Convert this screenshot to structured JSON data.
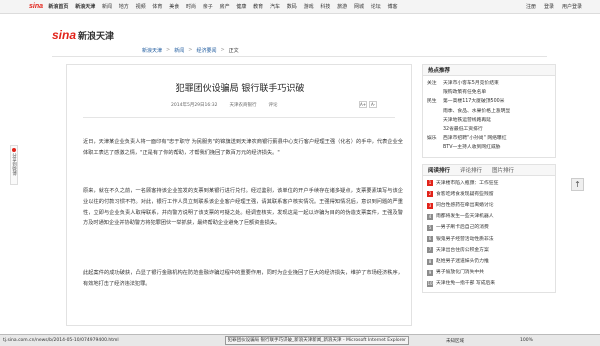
{
  "topnav": {
    "logo": "sina",
    "items": [
      "新浪首页",
      "新浪天津",
      "新闻",
      "地方",
      "视频",
      "体育",
      "美食",
      "时尚",
      "亲子",
      "房产",
      "健康",
      "教育",
      "汽车",
      "数码",
      "游戏",
      "科技",
      "旅游",
      "网城",
      "论坛",
      "博客"
    ],
    "register": "注册",
    "login": "登录",
    "user_center": "用户登录"
  },
  "brand": {
    "sina": "sina",
    "site": "新浪天津"
  },
  "breadcrumb": {
    "home": "新浪天津",
    "sep": ">",
    "news": "新闻",
    "economy": "经济要闻",
    "current": "正文"
  },
  "share": {
    "label": "分享到微博"
  },
  "article": {
    "title": "犯罪团伙设骗局 银行联手巧识破",
    "date": "2014年5月29日16:32",
    "source": "天津农商银行",
    "comment": "评论",
    "font_bigger": "A+",
    "font_smaller": "A-",
    "paragraphs": [
      "近日，天津某企业负责人将一面印有\"忠于职守 为民服务\"的锦旗送到天津农商银行蓟县中心支行客户经理王强（化名）的手中，代表企业全体职工表达了感激之情，\"正是有了你的帮助，才帮我们挽回了数百万元的经济损失。\"",
      "原来，就在不久之前，一名顾客持该企业签发的支票到某银行进行兑付。经过鉴别，该单位的开户手续存在诸多疑点，支票要素填写与该企业以往的付款习惯不符。对此，银行工作人员立刻联系该企业客户经理王强，请其联系客户核实情况。王强得知情况后，意识到问题的严重性，立即与企业负责人取得联系，并向警方说明了该支票的可疑之处。经调查核实，发现这是一起以诈骗为目的的伪造支票案件，王强及警方及时通知企业并协助警方将犯罪团伙一举抓获，最终帮助企业避免了巨额资金损失。",
      "此起案件的成功破获，凸显了银行金融机构在防范金融诈骗过程中的重要作用，同时为企业挽回了巨大的经济损失，维护了市场经济秩序，有效地打击了经济违法犯罪。"
    ]
  },
  "hot_recommend": {
    "title": "热点推荐",
    "rows": [
      {
        "cat": "关注",
        "text": "天津市小客车5月竞价结束"
      },
      {
        "cat": "",
        "text": "限购政策有任免名单"
      },
      {
        "cat": "民生",
        "text": "第一高楼117大厦破顶500米"
      },
      {
        "cat": "",
        "text": "雨季、食品、水果价格上涨明显"
      },
      {
        "cat": "",
        "text": "天津地铁运营线路再延"
      },
      {
        "cat": "",
        "text": "32省最低工资排行"
      },
      {
        "cat": "娱乐",
        "text": "西津市招聘\"小孙尚\" 网络曝红"
      },
      {
        "cat": "",
        "text": "BTV一主持人收到网红威胁"
      }
    ]
  },
  "ranking": {
    "tab_read": "阅读排行",
    "tab_comment": "评论排行",
    "tab_pic": "图片排行",
    "rows": [
      "天津楼市陷入瓶颈：工作狂狂",
      "食客吃烤食发现疑有些残留",
      "同台性感药在牵出离婚讨论",
      "雨都将发生一些天津机器人",
      "一男子刷卡后自己的消费",
      "银鬼男子经营活动性质非法",
      "天津出台住房公积金方案",
      "赵姓男子迷道妹头仍力推",
      "男子偷放化门消失中共",
      "天津住免一指干部 写成后来"
    ]
  },
  "back_to_top": "↑",
  "statusbar": {
    "url": "tj.sina.com.cn/news/b/2014-05-10/074979400.html",
    "task": "犯罪团伙设骗局 银行联手巧识破_新浪天津新闻_新浪天津 - Microsoft Internet Explorer",
    "zone": "未知区域",
    "zoom": "100%"
  }
}
